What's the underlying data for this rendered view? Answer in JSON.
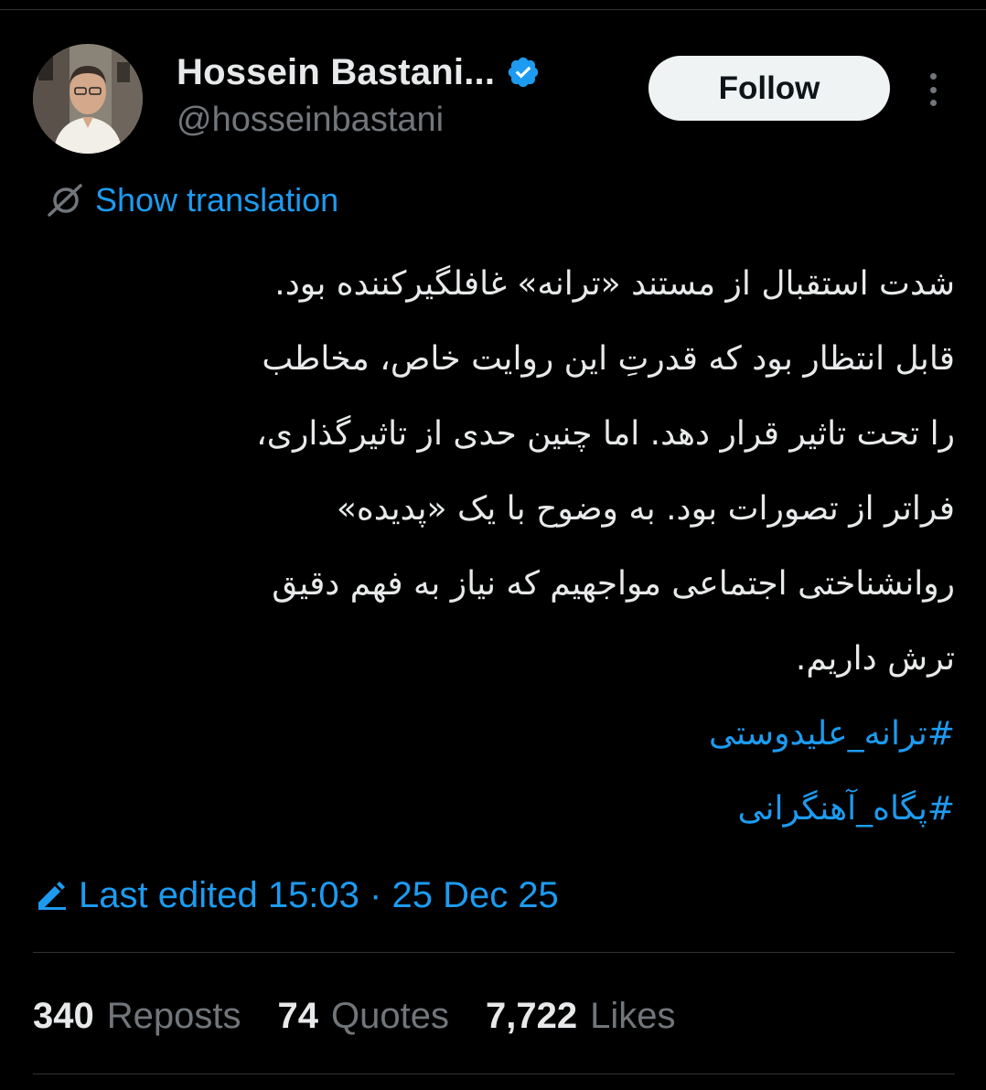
{
  "author": {
    "display_name": "Hossein Bastani...",
    "handle": "@hosseinbastani",
    "verified": true
  },
  "actions": {
    "follow_label": "Follow"
  },
  "translation": {
    "label": "Show translation"
  },
  "tweet": {
    "lines": [
      "شدت استقبال از مستند «ترانه» غافلگیرکننده بود.",
      "قابل انتظار بود که قدرتِ این روایت خاص، مخاطب",
      "را تحت تاثیر قرار دهد. اما چنین حدی از تاثیرگذاری،",
      "فراتر از تصورات بود. به وضوح با یک «پدیده»",
      "روانشناختی اجتماعی مواجهیم که نیاز به فهم دقیق",
      "ترش داریم."
    ],
    "hashtags": [
      "#ترانه_علیدوستی",
      "#پگاه_آهنگرانی"
    ]
  },
  "edited": {
    "text": "Last edited 15:03 · 25 Dec 25"
  },
  "stats": {
    "reposts_count": "340",
    "reposts_label": "Reposts",
    "quotes_count": "74",
    "quotes_label": "Quotes",
    "likes_count": "7,722",
    "likes_label": "Likes"
  },
  "colors": {
    "background": "#000000",
    "text_primary": "#e7e9ea",
    "text_secondary": "#71767b",
    "accent": "#1d9bf0",
    "divider": "#2f3336",
    "follow_bg": "#eff3f4"
  },
  "icons": {
    "verified": "verified-badge-icon",
    "more": "more-vertical-icon",
    "translate": "translate-icon",
    "edit": "edit-pencil-icon"
  }
}
